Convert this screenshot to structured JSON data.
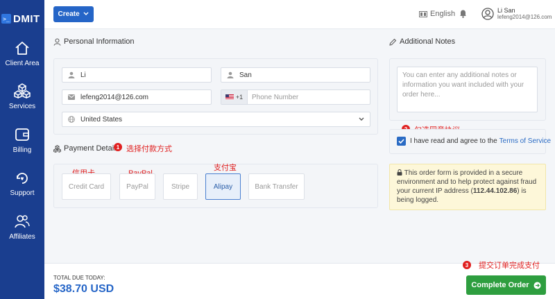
{
  "brand": {
    "logo_glyph": ">_",
    "name": "DMIT"
  },
  "sidebar": {
    "items": [
      {
        "label": "Client Area",
        "icon": "home-icon"
      },
      {
        "label": "Services",
        "icon": "cubes-icon"
      },
      {
        "label": "Billing",
        "icon": "wallet-icon"
      },
      {
        "label": "Support",
        "icon": "support-icon"
      },
      {
        "label": "Affiliates",
        "icon": "users-icon"
      }
    ]
  },
  "header": {
    "create_label": "Create",
    "language": "English",
    "user_name": "Li San",
    "user_email": "lefeng2014@126.com"
  },
  "personal": {
    "title": "Personal Information",
    "first_name": "Li",
    "last_name": "San",
    "email": "lefeng2014@126.com",
    "phone_code": "+1",
    "phone_placeholder": "Phone Number",
    "country": "United States"
  },
  "payment": {
    "title": "Payment Details",
    "methods": [
      "Credit Card",
      "PayPal",
      "Stripe",
      "Alipay",
      "Bank Transfer"
    ],
    "selected": "Alipay"
  },
  "notes": {
    "title": "Additional Notes",
    "placeholder": "You can enter any additional notes or information you want included with your order here..."
  },
  "agreement": {
    "text": "I have read and agree to the",
    "link": "Terms of Service",
    "checked": true
  },
  "security_notice": {
    "text_1": "This order form is provided in a secure environment and to help protect against fraud your current IP address (",
    "ip": "112.44.102.86",
    "text_2": ") is being logged."
  },
  "annotations": {
    "badge_1": "1",
    "note_1": "选择付款方式",
    "badge_2": "2",
    "note_2": "勾选同意协议",
    "badge_3": "3",
    "note_3": "提交订单完成支付",
    "credit_card": "信用卡",
    "paypal": "PayPal",
    "alipay": "支付宝"
  },
  "footer": {
    "total_label": "TOTAL DUE TODAY:",
    "total_value": "$38.70 USD",
    "complete_label": "Complete Order"
  },
  "colors": {
    "sidebar": "#1a3e8f",
    "primary": "#2565c7",
    "success": "#2e9e3f",
    "annotation": "#e02020",
    "warning_bg": "#fdf7d9"
  }
}
